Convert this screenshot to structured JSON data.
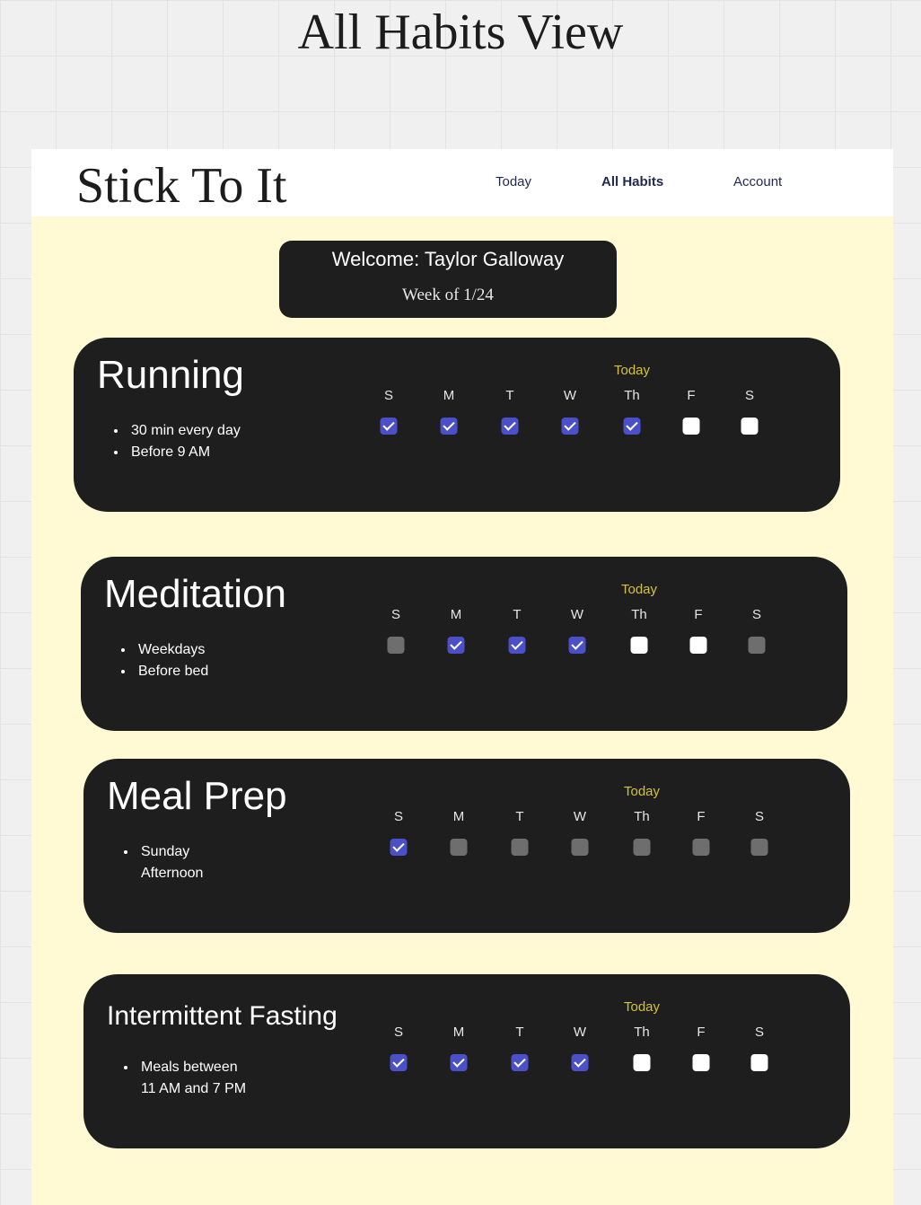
{
  "frame_title": "All Habits View",
  "app": {
    "logo": "Stick To It",
    "nav": [
      {
        "label": "Today",
        "active": false
      },
      {
        "label": "All Habits",
        "active": true
      },
      {
        "label": "Account",
        "active": false
      }
    ]
  },
  "welcome": {
    "greeting": "Welcome: Taylor Galloway",
    "week": "Week of 1/24"
  },
  "colors": {
    "page_background": "#fffad4",
    "card_background": "#1e1e1e",
    "checked": "#4c50c8",
    "unchecked": "#ffffff",
    "disabled": "#6e6e6e",
    "today_label": "#d4c23a"
  },
  "days": [
    "S",
    "M",
    "T",
    "W",
    "Th",
    "F",
    "S"
  ],
  "today_label": "Today",
  "habits": [
    {
      "name": "Running",
      "notes": [
        "30 min every day",
        "Before 9 AM"
      ],
      "states": [
        "checked",
        "checked",
        "checked",
        "checked",
        "checked",
        "unchecked",
        "unchecked"
      ]
    },
    {
      "name": "Meditation",
      "notes": [
        "Weekdays",
        "Before bed"
      ],
      "states": [
        "disabled",
        "checked",
        "checked",
        "checked",
        "unchecked",
        "unchecked",
        "disabled"
      ]
    },
    {
      "name": "Meal Prep",
      "notes": [
        "Sunday\nAfternoon"
      ],
      "states": [
        "checked",
        "disabled",
        "disabled",
        "disabled",
        "disabled",
        "disabled",
        "disabled"
      ]
    },
    {
      "name": "Intermittent Fasting",
      "notes": [
        "Meals between\n11 AM and 7 PM"
      ],
      "states": [
        "checked",
        "checked",
        "checked",
        "checked",
        "unchecked",
        "unchecked",
        "unchecked"
      ]
    }
  ]
}
